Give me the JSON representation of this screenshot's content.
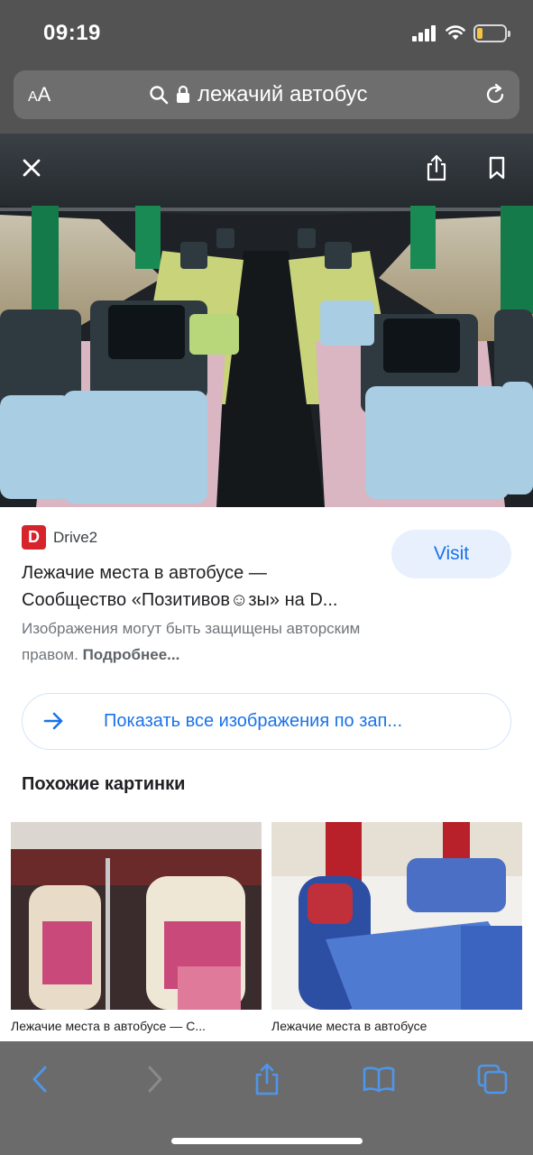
{
  "status_bar": {
    "time": "09:19",
    "battery_level": 0.2
  },
  "address_bar": {
    "text_size_label_small": "A",
    "text_size_label_large": "A",
    "url_text": "лежачий автобус"
  },
  "result": {
    "source_logo_letter": "D",
    "source_name": "Drive2",
    "visit_label": "Visit",
    "title_line1": "Лежачие места в автобусе —",
    "title_line2": "Сообщество «Позитивов☺зы» на D...",
    "copyright_text": "Изображения могут быть защищены авторским правом.",
    "learn_more": "Подробнее..."
  },
  "show_all": {
    "label": "Показать все изображения по зап..."
  },
  "similar": {
    "heading": "Похожие картинки",
    "items": [
      {
        "caption": "Лежачие места в автобусе — С..."
      },
      {
        "caption": "Лежачие места в автобусе"
      }
    ]
  },
  "colors": {
    "accent": "#1a73e8",
    "chrome": "#535353",
    "toolbar": "#6b6b6b",
    "brand_red": "#d6232c"
  }
}
